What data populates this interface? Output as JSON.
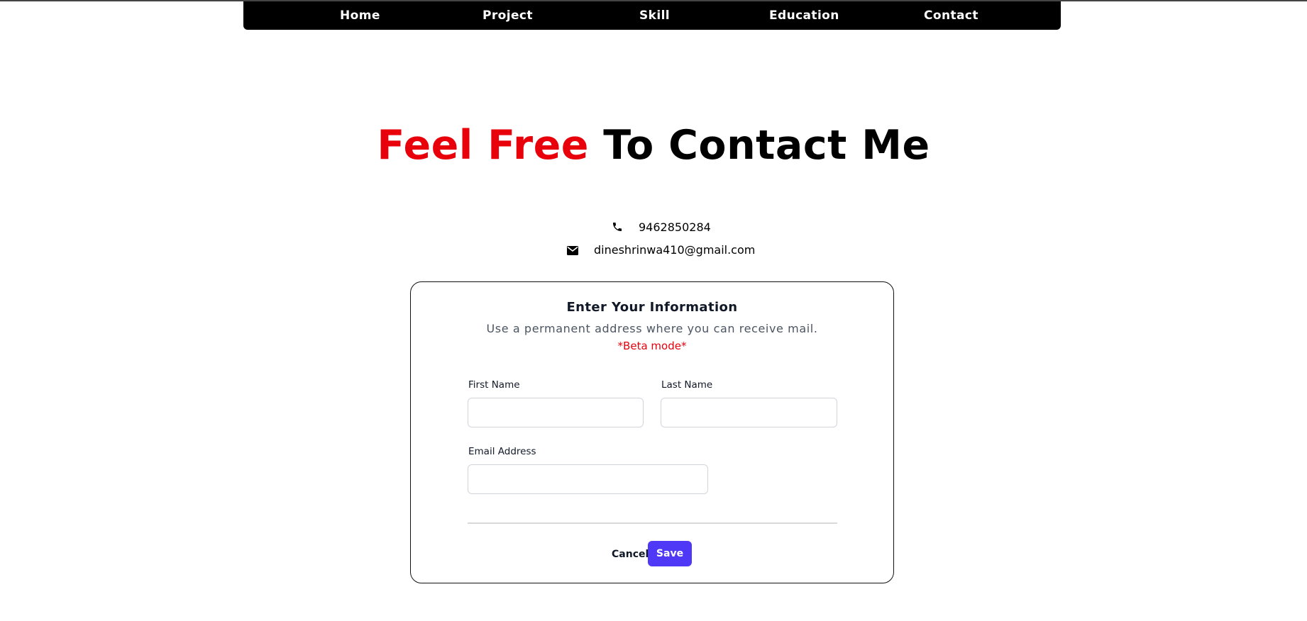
{
  "nav": {
    "items": [
      {
        "label": "Home"
      },
      {
        "label": "Project"
      },
      {
        "label": "Skill"
      },
      {
        "label": "Education"
      },
      {
        "label": "Contact"
      }
    ]
  },
  "hero": {
    "accent": "Feel Free",
    "rest": "To Contact Me"
  },
  "contact": {
    "phone": "9462850284",
    "email": "dineshrinwa410@gmail.com",
    "phone_icon": "phone-icon",
    "email_icon": "envelope-icon"
  },
  "form": {
    "title": "Enter Your Information",
    "subtitle": "Use a permanent address where you can receive mail.",
    "beta_note": "*Beta mode*",
    "first_name_label": "First Name",
    "first_name_value": "",
    "last_name_label": "Last Name",
    "last_name_value": "",
    "email_label": "Email Address",
    "email_value": "",
    "cancel_label": "Cancel",
    "save_label": "Save"
  },
  "colors": {
    "accent_red": "#e8000b",
    "save_button": "#4f39f6",
    "navbar_bg": "#000000"
  }
}
